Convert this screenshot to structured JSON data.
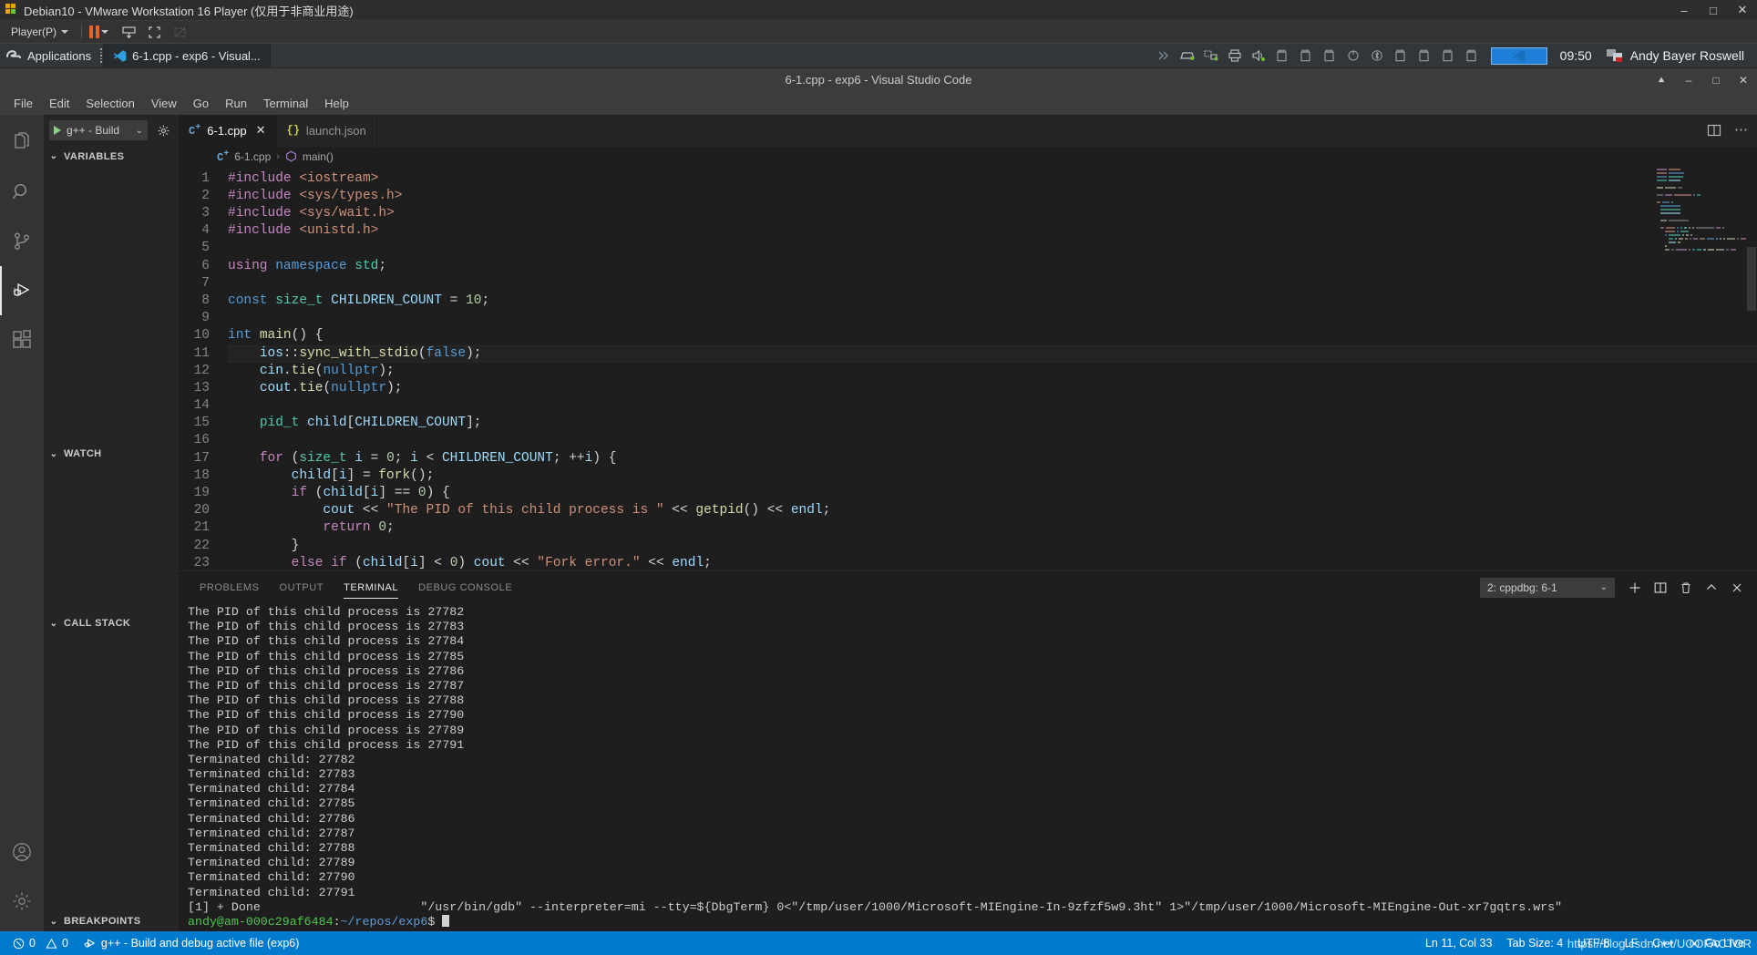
{
  "vmware": {
    "title": "Debian10 - VMware Workstation 16 Player (仅用于非商业用途)",
    "menu_label": "Player(P)",
    "window_controls": {
      "minimize": "–",
      "maximize": "□",
      "close": "✕"
    },
    "toolbar_icons": [
      "pause-icon",
      "send-ctrl-alt-del-icon",
      "fullscreen-icon",
      "unity-mode-icon"
    ]
  },
  "gnome_panel": {
    "applications_label": "Applications",
    "task_label": "6-1.cpp - exp6 - Visual...",
    "clock": "09:50",
    "user": "Andy Bayer Roswell",
    "tray_icons": [
      "expand-icon",
      "drive-icon",
      "network-icon",
      "printer-icon",
      "volume-icon",
      "battery-icon",
      "battery-icon",
      "battery-icon",
      "power-icon",
      "bluetooth-icon",
      "battery-icon",
      "battery-icon",
      "battery-icon",
      "battery-icon"
    ]
  },
  "vscode": {
    "window_title": "6-1.cpp - exp6 - Visual Studio Code",
    "titlebar_controls": {
      "restore_up": "⯅",
      "minimize": "–",
      "maximize": "□",
      "close": "✕"
    },
    "menus": [
      "File",
      "Edit",
      "Selection",
      "View",
      "Go",
      "Run",
      "Terminal",
      "Help"
    ],
    "activitybar": [
      {
        "name": "explorer",
        "icon": "files-icon",
        "active": false
      },
      {
        "name": "search",
        "icon": "search-icon",
        "active": false
      },
      {
        "name": "source-control",
        "icon": "source-control-icon",
        "active": false
      },
      {
        "name": "run-and-debug",
        "icon": "run-debug-icon",
        "active": true
      },
      {
        "name": "extensions",
        "icon": "extensions-icon",
        "active": false
      }
    ],
    "activitybar_bottom": [
      {
        "name": "accounts",
        "icon": "account-icon"
      },
      {
        "name": "manage",
        "icon": "gear-icon"
      }
    ],
    "sidebar": {
      "launch_config": "g++ - Build",
      "sections": [
        "VARIABLES",
        "WATCH",
        "CALL STACK",
        "BREAKPOINTS"
      ]
    },
    "tabs": [
      {
        "label": "6-1.cpp",
        "icon": "cpp-file-icon",
        "active": true,
        "close": "✕"
      },
      {
        "label": "launch.json",
        "icon": "json-file-icon",
        "active": false,
        "close": ""
      }
    ],
    "editor_actions": [
      "split-editor-icon",
      "more-actions-icon"
    ],
    "breadcrumb": {
      "file": "6-1.cpp",
      "separator": "›",
      "symbol": "main()"
    },
    "code": {
      "first_line_number": 1,
      "current_line": 11,
      "lines": [
        {
          "n": 1,
          "html": "<span class='tk-pre'>#include</span> <span class='tk-str'>&lt;iostream&gt;</span>"
        },
        {
          "n": 2,
          "html": "<span class='tk-pre'>#include</span> <span class='tk-str'>&lt;sys/types.h&gt;</span>"
        },
        {
          "n": 3,
          "html": "<span class='tk-pre'>#include</span> <span class='tk-str'>&lt;sys/wait.h&gt;</span>"
        },
        {
          "n": 4,
          "html": "<span class='tk-pre'>#include</span> <span class='tk-str'>&lt;unistd.h&gt;</span>"
        },
        {
          "n": 5,
          "html": ""
        },
        {
          "n": 6,
          "html": "<span class='tk-pre'>using</span> <span class='tk-key'>namespace</span> <span class='tk-type'>std</span>;"
        },
        {
          "n": 7,
          "html": ""
        },
        {
          "n": 8,
          "html": "<span class='tk-key'>const</span> <span class='tk-type'>size_t</span> <span class='tk-var'>CHILDREN_COUNT</span> = <span class='tk-num'>10</span>;"
        },
        {
          "n": 9,
          "html": ""
        },
        {
          "n": 10,
          "html": "<span class='tk-key'>int</span> <span class='tk-fn'>main</span>() {"
        },
        {
          "n": 11,
          "html": "    <span class='tk-var'>ios</span>::<span class='tk-fn'>sync_with_stdio</span>(<span class='tk-key'>false</span>);"
        },
        {
          "n": 12,
          "html": "    <span class='tk-var'>cin</span>.<span class='tk-fn'>tie</span>(<span class='tk-key'>nullptr</span>);"
        },
        {
          "n": 13,
          "html": "    <span class='tk-var'>cout</span>.<span class='tk-fn'>tie</span>(<span class='tk-key'>nullptr</span>);"
        },
        {
          "n": 14,
          "html": ""
        },
        {
          "n": 15,
          "html": "    <span class='tk-type'>pid_t</span> <span class='tk-var'>child</span>[<span class='tk-var'>CHILDREN_COUNT</span>];"
        },
        {
          "n": 16,
          "html": ""
        },
        {
          "n": 17,
          "html": "    <span class='tk-pre'>for</span> (<span class='tk-type'>size_t</span> <span class='tk-var'>i</span> = <span class='tk-num'>0</span>; <span class='tk-var'>i</span> &lt; <span class='tk-var'>CHILDREN_COUNT</span>; ++<span class='tk-var'>i</span>) {"
        },
        {
          "n": 18,
          "html": "        <span class='tk-var'>child</span>[<span class='tk-var'>i</span>] = <span class='tk-fn'>fork</span>();"
        },
        {
          "n": 19,
          "html": "        <span class='tk-pre'>if</span> (<span class='tk-var'>child</span>[<span class='tk-var'>i</span>] == <span class='tk-num'>0</span>) {"
        },
        {
          "n": 20,
          "html": "            <span class='tk-var'>cout</span> &lt;&lt; <span class='tk-str'>\"The PID of this child process is \"</span> &lt;&lt; <span class='tk-fn'>getpid</span>() &lt;&lt; <span class='tk-var'>endl</span>;"
        },
        {
          "n": 21,
          "html": "            <span class='tk-pre'>return</span> <span class='tk-num'>0</span>;"
        },
        {
          "n": 22,
          "html": "        }"
        },
        {
          "n": 23,
          "html": "        <span class='tk-pre'>else if</span> (<span class='tk-var'>child</span>[<span class='tk-var'>i</span>] &lt; <span class='tk-num'>0</span>) <span class='tk-var'>cout</span> &lt;&lt; <span class='tk-str'>\"Fork error.\"</span> &lt;&lt; <span class='tk-var'>endl</span>;"
        }
      ],
      "plain_lines": [
        "#include <iostream>",
        "#include <sys/types.h>",
        "#include <sys/wait.h>",
        "#include <unistd.h>",
        "",
        "using namespace std;",
        "",
        "const size_t CHILDREN_COUNT = 10;",
        "",
        "int main() {",
        "    ios::sync_with_stdio(false);",
        "    cin.tie(nullptr);",
        "    cout.tie(nullptr);",
        "",
        "    pid_t child[CHILDREN_COUNT];",
        "",
        "    for (size_t i = 0; i < CHILDREN_COUNT; ++i) {",
        "        child[i] = fork();",
        "        if (child[i] == 0) {",
        "            cout << \"The PID of this child process is \" << getpid() << endl;",
        "            return 0;",
        "        }",
        "        else if (child[i] < 0) cout << \"Fork error.\" << endl;"
      ]
    },
    "panel": {
      "tabs": [
        {
          "label": "PROBLEMS",
          "active": false
        },
        {
          "label": "OUTPUT",
          "active": false
        },
        {
          "label": "TERMINAL",
          "active": true
        },
        {
          "label": "DEBUG CONSOLE",
          "active": false
        }
      ],
      "terminal_select": "2: cppdbg: 6-1",
      "select_chevron": "⌄",
      "actions": [
        {
          "name": "new-terminal-button",
          "glyph": "＋"
        },
        {
          "name": "split-terminal-button",
          "glyph": "◫"
        },
        {
          "name": "kill-terminal-button",
          "glyph": "🗑"
        },
        {
          "name": "maximize-panel-button",
          "glyph": "⌃"
        },
        {
          "name": "close-panel-button",
          "glyph": "✕"
        }
      ],
      "terminal_lines": [
        "The PID of this child process is 27782",
        "The PID of this child process is 27783",
        "The PID of this child process is 27784",
        "The PID of this child process is 27785",
        "The PID of this child process is 27786",
        "The PID of this child process is 27787",
        "The PID of this child process is 27788",
        "The PID of this child process is 27790",
        "The PID of this child process is 27789",
        "The PID of this child process is 27791",
        "Terminated child: 27782",
        "Terminated child: 27783",
        "Terminated child: 27784",
        "Terminated child: 27785",
        "Terminated child: 27786",
        "Terminated child: 27787",
        "Terminated child: 27788",
        "Terminated child: 27789",
        "Terminated child: 27790",
        "Terminated child: 27791"
      ],
      "done_line": "[1] + Done                      \"/usr/bin/gdb\" --interpreter=mi --tty=${DbgTerm} 0<\"/tmp/user/1000/Microsoft-MIEngine-In-9zfzf5w9.3ht\" 1>\"/tmp/user/1000/Microsoft-MIEngine-Out-xr7gqtrs.wrs\"",
      "prompt": {
        "user_host": "andy@am-000c29af6484",
        "colon": ":",
        "path": "~/repos/exp6",
        "sigil": "$"
      }
    },
    "statusbar": {
      "errors": "0",
      "warnings": "0",
      "debug_task": "g++ - Build and debug active file (exp6)",
      "cursor": "Ln 11, Col 33",
      "tab_size": "Tab Size: 4",
      "encoding": "UTF-8",
      "eol": "LF",
      "language": "C++",
      "go_live": "Go Live",
      "watermark": "https://blog.csdn.net/UOOFACTOR",
      "accent": "#007acc"
    }
  }
}
